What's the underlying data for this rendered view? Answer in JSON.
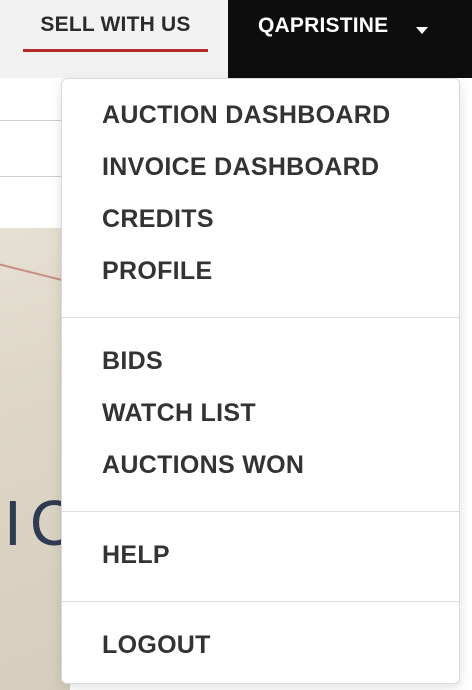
{
  "header": {
    "sell_label": "SELL WITH US",
    "account_label": "QAPRISTINE"
  },
  "hero": {
    "partial_text": "IC"
  },
  "account_menu": {
    "groups": [
      [
        "AUCTION DASHBOARD",
        "INVOICE DASHBOARD",
        "CREDITS",
        "PROFILE"
      ],
      [
        "BIDS",
        "WATCH LIST",
        "AUCTIONS WON"
      ],
      [
        "HELP"
      ],
      [
        "LOGOUT"
      ]
    ]
  },
  "colors": {
    "accent_underline": "#b52a2a",
    "account_bg": "#0d0d0d",
    "menu_text": "#333333"
  }
}
